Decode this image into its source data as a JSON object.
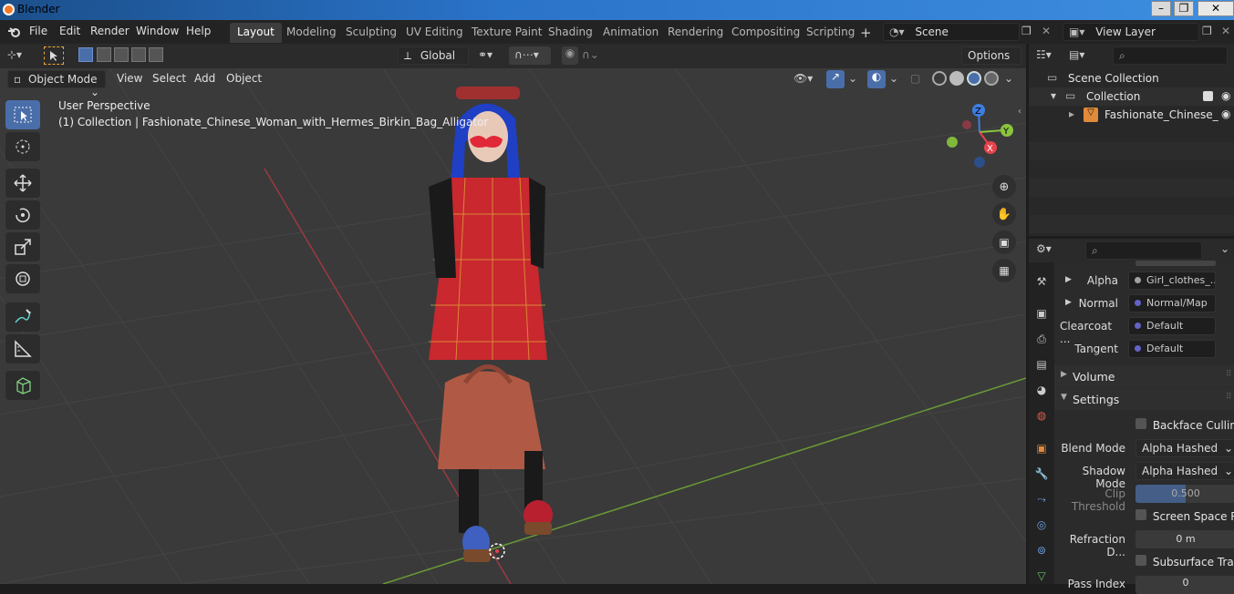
{
  "window": {
    "title": "Blender"
  },
  "menu": [
    "File",
    "Edit",
    "Render",
    "Window",
    "Help"
  ],
  "workspaces": [
    "Layout",
    "Modeling",
    "Sculpting",
    "UV Editing",
    "Texture Paint",
    "Shading",
    "Animation",
    "Rendering",
    "Compositing",
    "Scripting"
  ],
  "scene": {
    "label": "Scene",
    "view_layer": "View Layer"
  },
  "toolbar": {
    "orientation": "Global",
    "options": "Options"
  },
  "viewport_header": {
    "mode": "Object Mode",
    "menus": [
      "View",
      "Select",
      "Add",
      "Object"
    ]
  },
  "viewport": {
    "perspective": "User Perspective",
    "collection_info": "(1) Collection | Fashionate_Chinese_Woman_with_Hermes_Birkin_Bag_Alligator"
  },
  "gizmo": {
    "z": "Z",
    "y": "Y",
    "x": "X"
  },
  "outliner": {
    "scene_collection": "Scene Collection",
    "collection": "Collection",
    "object": "Fashionate_Chinese_"
  },
  "properties": {
    "inputs": [
      {
        "label": "Alpha",
        "value": "Girl_clothes_...",
        "dot": "grey"
      },
      {
        "label": "Normal",
        "value": "Normal/Map",
        "dot": "blue"
      },
      {
        "label": "Clearcoat ...",
        "value": "Default",
        "dot": "blue"
      },
      {
        "label": "Tangent",
        "value": "Default",
        "dot": "blue"
      }
    ],
    "volume_section": "Volume",
    "settings_section": "Settings",
    "backface_culling": "Backface Culling",
    "blend_mode_label": "Blend Mode",
    "blend_mode_value": "Alpha Hashed",
    "shadow_mode_label": "Shadow Mode",
    "shadow_mode_value": "Alpha Hashed",
    "clip_threshold_label": "Clip Threshold",
    "clip_threshold_value": "0.500",
    "screen_space": "Screen Space R...",
    "refraction_label": "Refraction D...",
    "refraction_value": "0 m",
    "subsurface": "Subsurface Tran...",
    "pass_index_label": "Pass Index",
    "pass_index_value": "0"
  },
  "colors": {
    "accent": "#4a6ea9",
    "x_axis": "#e8424d",
    "y_axis": "#8bc43f",
    "z_axis": "#3d7ee0",
    "active_tool": "#4a6ea9"
  }
}
